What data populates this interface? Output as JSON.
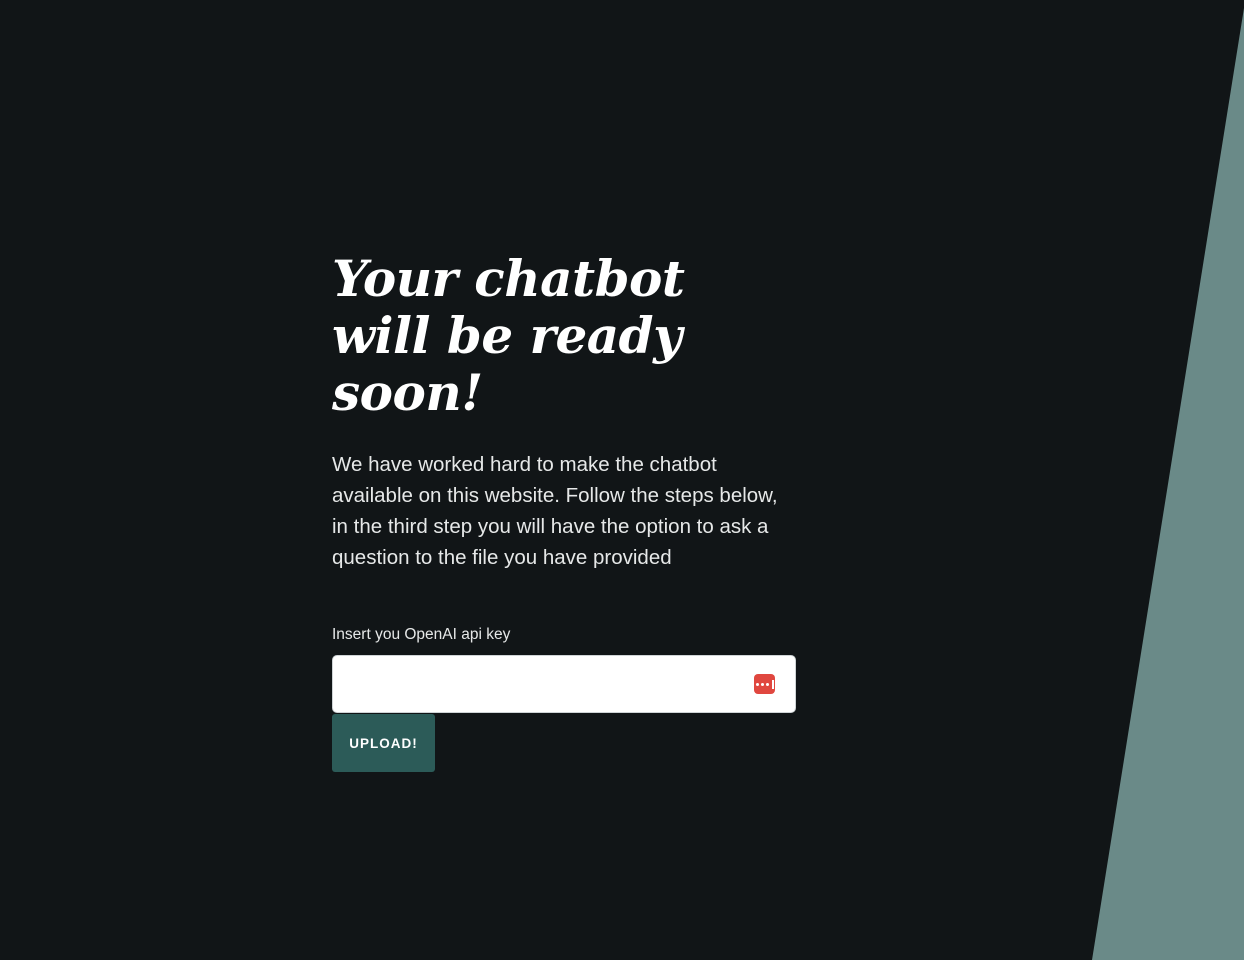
{
  "hero": {
    "title": "Your chatbot will be ready soon!",
    "description": "We have worked hard to make the chatbot available on this website. Follow the steps below, in the third step you will have the option to ask a question to the file you have provided"
  },
  "form": {
    "api_key_label": "Insert you OpenAI api key",
    "api_key_value": "",
    "password_manager_icon": "password-manager-icon",
    "upload_label": "UPLOAD!"
  },
  "colors": {
    "background": "#111517",
    "accent_shape": "#6a8a88",
    "button": "#2c5b58",
    "icon": "#e0473f"
  }
}
